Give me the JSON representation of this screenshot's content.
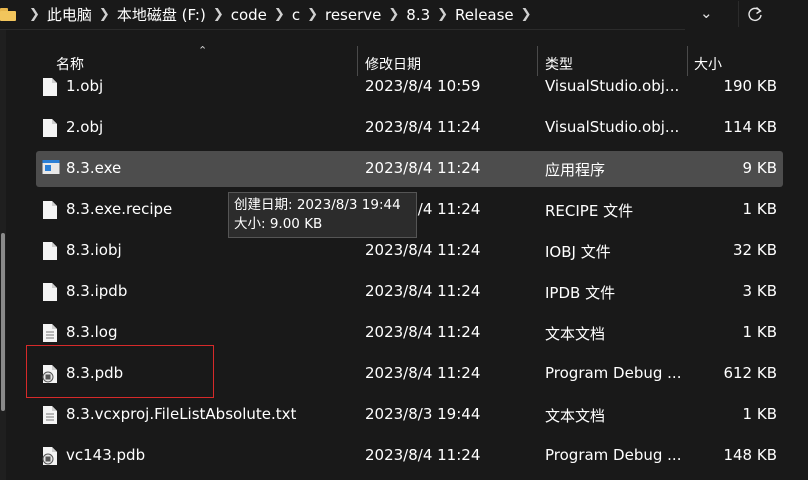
{
  "breadcrumb": {
    "items": [
      "此电脑",
      "本地磁盘 (F:)",
      "code",
      "c",
      "reserve",
      "8.3",
      "Release"
    ]
  },
  "columns": {
    "name": "名称",
    "date": "修改日期",
    "type": "类型",
    "size": "大小"
  },
  "files": [
    {
      "name": "1.obj",
      "date": "2023/8/4 10:59",
      "type": "VisualStudio.obj...",
      "size": "190 KB",
      "icon": "document-icon"
    },
    {
      "name": "2.obj",
      "date": "2023/8/4 11:24",
      "type": "VisualStudio.obj...",
      "size": "114 KB",
      "icon": "document-icon"
    },
    {
      "name": "8.3.exe",
      "date": "2023/8/4 11:24",
      "type": "应用程序",
      "size": "9 KB",
      "icon": "exe-icon"
    },
    {
      "name": "8.3.exe.recipe",
      "date": "2023/8/4 11:24",
      "type": "RECIPE 文件",
      "size": "1 KB",
      "icon": "document-icon"
    },
    {
      "name": "8.3.iobj",
      "date": "2023/8/4 11:24",
      "type": "IOBJ 文件",
      "size": "32 KB",
      "icon": "document-icon"
    },
    {
      "name": "8.3.ipdb",
      "date": "2023/8/4 11:24",
      "type": "IPDB 文件",
      "size": "3 KB",
      "icon": "document-icon"
    },
    {
      "name": "8.3.log",
      "date": "2023/8/4 11:24",
      "type": "文本文档",
      "size": "1 KB",
      "icon": "text-document-icon"
    },
    {
      "name": "8.3.pdb",
      "date": "2023/8/4 11:24",
      "type": "Program Debug ...",
      "size": "612 KB",
      "icon": "pdb-icon"
    },
    {
      "name": "8.3.vcxproj.FileListAbsolute.txt",
      "date": "2023/8/3 19:44",
      "type": "文本文档",
      "size": "1 KB",
      "icon": "text-document-icon"
    },
    {
      "name": "vc143.pdb",
      "date": "2023/8/4 11:24",
      "type": "Program Debug ...",
      "size": "148 KB",
      "icon": "pdb-icon"
    }
  ],
  "selected_index": 2,
  "tooltip": {
    "created": "创建日期: 2023/8/3 19:44",
    "size": "大小: 9.00 KB"
  },
  "colors": {
    "background": "#191919",
    "selected_row": "#4d4d4d",
    "highlight_box": "#d62a2a",
    "folder": "#f2c55c"
  }
}
